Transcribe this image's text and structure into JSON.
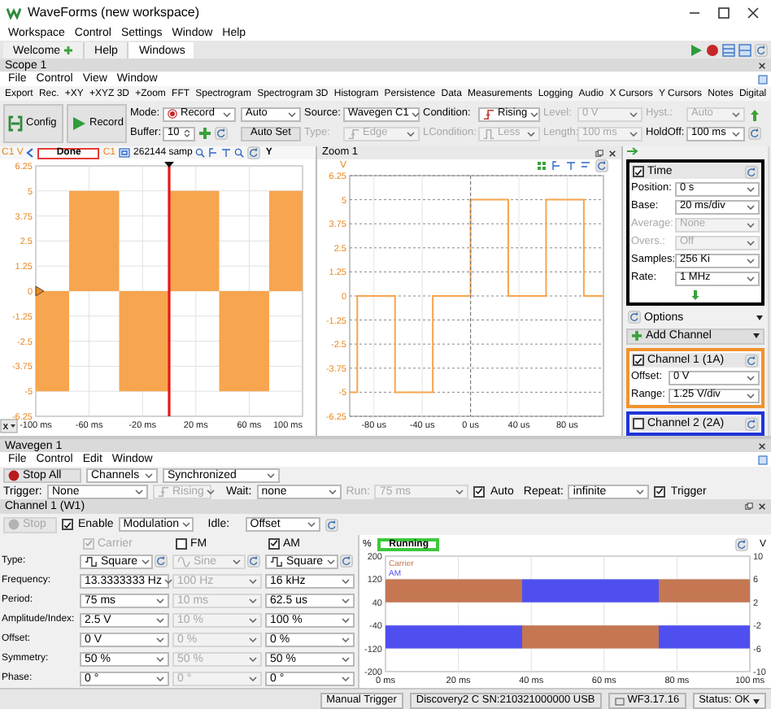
{
  "window": {
    "title": "WaveForms (new workspace)"
  },
  "menu": [
    "Workspace",
    "Control",
    "Settings",
    "Window",
    "Help"
  ],
  "tabs": [
    {
      "label": "Welcome",
      "selected": false
    },
    {
      "label": "Help",
      "selected": false
    },
    {
      "label": "Windows",
      "selected": true
    }
  ],
  "scope": {
    "title": "Scope 1",
    "menu": [
      "File",
      "Control",
      "View",
      "Window"
    ],
    "toolbar": [
      "Export",
      "Rec.",
      "+XY",
      "+XYZ 3D",
      "+Zoom",
      "FFT",
      "Spectrogram",
      "Spectrogram 3D",
      "Histogram",
      "Persistence",
      "Data",
      "Measurements",
      "Logging",
      "Audio",
      "X Cursors",
      "Y Cursors",
      "Notes",
      "Digital"
    ],
    "config": "Config",
    "record": "Record",
    "mode_label": "Mode:",
    "mode": "Record",
    "acquisition": "Auto",
    "buffer_label": "Buffer:",
    "buffer": "10",
    "auto_set": "Auto Set",
    "trigger": [
      {
        "label": "Source:",
        "value": "Wavegen C1",
        "disabled": false,
        "kind": "text"
      },
      {
        "label": "Type:",
        "value": "Edge",
        "disabled": true,
        "kind": "edge"
      },
      {
        "label": "Condition:",
        "value": "Rising",
        "disabled": false,
        "kind": "edge"
      },
      {
        "label": "LCondition:",
        "value": "Less",
        "disabled": true,
        "kind": "pulse"
      },
      {
        "label": "Level:",
        "value": "0 V",
        "disabled": true,
        "kind": "text"
      },
      {
        "label": "Length:",
        "value": "100 ms",
        "disabled": true,
        "kind": "text"
      },
      {
        "label": "Hyst.:",
        "value": "Auto",
        "disabled": true,
        "kind": "text"
      },
      {
        "label": "HoldOff:",
        "value": "100 ms",
        "disabled": false,
        "kind": "text"
      }
    ],
    "plot": {
      "status": "Done",
      "samples": "262144 samp",
      "x_menu": "X",
      "y_menu": "Y",
      "chart_data": {
        "type": "area",
        "ylabel": "C1 V",
        "grid": true,
        "ref_lines": [
          {
            "axis": "x",
            "value": 0,
            "color": "#e01b1b"
          }
        ],
        "xlim": [
          -100,
          100
        ],
        "ylim": [
          -6.25,
          6.25
        ],
        "xticks": [
          {
            "value": -100,
            "label": "-100 ms"
          },
          {
            "value": -60,
            "label": "-60 ms"
          },
          {
            "value": -20,
            "label": "-20 ms"
          },
          {
            "value": 20,
            "label": "20 ms"
          },
          {
            "value": 60,
            "label": "60 ms"
          },
          {
            "value": 100,
            "label": "100 ms"
          }
        ],
        "yticks": [
          6.25,
          5,
          3.75,
          2.5,
          1.25,
          0,
          -1.25,
          -2.5,
          -3.75,
          -5,
          -6.25
        ],
        "x": [
          -100,
          -75,
          -75,
          -37.5,
          -37.5,
          0,
          0,
          37.5,
          37.5,
          75,
          75,
          100
        ],
        "series": [
          {
            "name": "C1",
            "color": "#f7a54f",
            "values": [
              -5,
              -5,
              5,
              5,
              -5,
              -5,
              5,
              5,
              -5,
              -5,
              5,
              5
            ]
          }
        ]
      }
    },
    "zoom": {
      "title": "Zoom 1",
      "chart_data": {
        "type": "line",
        "ylabel": "V",
        "grid": true,
        "ref_lines": [
          {
            "axis": "x",
            "value": 0,
            "color": "#777777"
          }
        ],
        "xlim": [
          -100,
          110
        ],
        "ylim": [
          -6.25,
          6.25
        ],
        "xticks": [
          {
            "value": -80,
            "label": "-80 us"
          },
          {
            "value": -40,
            "label": "-40 us"
          },
          {
            "value": 0,
            "label": "0 us"
          },
          {
            "value": 40,
            "label": "40 us"
          },
          {
            "value": 80,
            "label": "80 us"
          }
        ],
        "yticks": [
          6.25,
          5,
          3.75,
          2.5,
          1.25,
          0,
          -1.25,
          -2.5,
          -3.75,
          -5,
          -6.25
        ],
        "x": [
          -100,
          -93.75,
          -93.75,
          -62.5,
          -62.5,
          -31.25,
          -31.25,
          0,
          0,
          31.25,
          31.25,
          62.5,
          62.5,
          93.75,
          93.75,
          110
        ],
        "series": [
          {
            "color": "#f7a54f",
            "values": [
              -5,
              -5,
              0,
              0,
              -5,
              -5,
              0,
              0,
              5,
              5,
              0,
              0,
              5,
              5,
              0,
              0
            ]
          }
        ]
      }
    },
    "panel": {
      "time": {
        "label": "Time",
        "checked": true,
        "rows": [
          {
            "label": "Position:",
            "value": "0 s",
            "disabled": false
          },
          {
            "label": "Base:",
            "value": "20 ms/div",
            "disabled": false
          },
          {
            "label": "Average:",
            "value": "None",
            "disabled": true
          },
          {
            "label": "Overs.:",
            "value": "Off",
            "disabled": true
          },
          {
            "label": "Samples:",
            "value": "256 Ki",
            "disabled": false
          },
          {
            "label": "Rate:",
            "value": "1 MHz",
            "disabled": false
          }
        ]
      },
      "options": "Options",
      "add_channel": "Add Channel",
      "channels": [
        {
          "label": "Channel 1 (1A)",
          "checked": true,
          "color": "#f0922e",
          "rows": [
            {
              "label": "Offset:",
              "value": "0 V"
            },
            {
              "label": "Range:",
              "value": "1.25 V/div"
            }
          ]
        },
        {
          "label": "Channel 2 (2A)",
          "checked": false,
          "color": "#1f35d8"
        }
      ]
    }
  },
  "wavegen": {
    "title": "Wavegen 1",
    "menu": [
      "File",
      "Control",
      "Edit",
      "Window"
    ],
    "stop_all": "Stop All",
    "channels": "Channels",
    "sync": "Synchronized",
    "trigger_label": "Trigger:",
    "trigger": "None",
    "edge": {
      "value": "Rising",
      "disabled": true
    },
    "wait_label": "Wait:",
    "wait": "none",
    "run_label": "Run:",
    "run": {
      "value": "75 ms",
      "disabled": true
    },
    "auto": {
      "label": "Auto",
      "checked": true
    },
    "repeat_label": "Repeat:",
    "repeat": "infinite",
    "trigger_check": {
      "label": "Trigger",
      "checked": true
    },
    "channel_title": "Channel 1 (W1)",
    "stop": {
      "label": "Stop",
      "disabled": true
    },
    "enable": {
      "label": "Enable",
      "checked": true
    },
    "mode": "Modulation",
    "idle_label": "Idle:",
    "idle": "Offset",
    "columns": [
      {
        "label": "Carrier",
        "checked": true,
        "disabled": true
      },
      {
        "label": "FM",
        "checked": false,
        "disabled": false
      },
      {
        "label": "AM",
        "checked": true,
        "disabled": false
      }
    ],
    "rows": [
      {
        "label": "Type:",
        "kind": "wave",
        "values": [
          {
            "text": "Square",
            "kind": "square"
          },
          {
            "text": "Sine",
            "kind": "sine"
          },
          {
            "text": "Square",
            "kind": "square"
          }
        ]
      },
      {
        "label": "Frequency:",
        "kind": "value",
        "values": [
          "13.3333333 Hz",
          "100 Hz",
          "16 kHz"
        ]
      },
      {
        "label": "Period:",
        "kind": "value",
        "values": [
          "75 ms",
          "10 ms",
          "62.5 us"
        ]
      },
      {
        "label": "Amplitude/Index:",
        "kind": "value",
        "values": [
          "2.5 V",
          "10 %",
          "100 %"
        ]
      },
      {
        "label": "Offset:",
        "kind": "value",
        "values": [
          "0 V",
          "0 %",
          "0 %"
        ]
      },
      {
        "label": "Symmetry:",
        "kind": "value",
        "values": [
          "50 %",
          "50 %",
          "50 %"
        ]
      },
      {
        "label": "Phase:",
        "kind": "value",
        "values": [
          "0 °",
          "0 °",
          "0 °"
        ]
      }
    ],
    "status": "Running",
    "chart_data": {
      "type": "area",
      "ylabel": "%",
      "y2label": "V",
      "grid": true,
      "xlim": [
        0,
        100
      ],
      "ylim": [
        -200,
        200
      ],
      "y2lim": [
        -10,
        10
      ],
      "xticks": [
        {
          "value": 0,
          "label": "0 ms"
        },
        {
          "value": 20,
          "label": "20 ms"
        },
        {
          "value": 40,
          "label": "40 ms"
        },
        {
          "value": 60,
          "label": "60 ms"
        },
        {
          "value": 80,
          "label": "80 ms"
        },
        {
          "value": 100,
          "label": "100 ms"
        }
      ],
      "yticks": [
        200,
        120,
        40,
        -40,
        -120,
        -200
      ],
      "y2ticks": [
        10,
        6,
        2,
        -2,
        -6,
        -10
      ],
      "x": [
        0,
        37.5,
        37.5,
        75,
        75,
        100
      ],
      "series": [
        {
          "name": "Carrier",
          "color": "#c47752",
          "values": [
            120,
            120,
            -120,
            -120,
            120,
            120
          ]
        },
        {
          "name": "AM",
          "color": "#4f4ff0",
          "values": [
            -120,
            -120,
            120,
            120,
            -120,
            -120
          ]
        }
      ]
    }
  },
  "status_bar": [
    "Manual Trigger",
    "Discovery2 C SN:210321000000 USB",
    "WF3.17.16",
    "Status: OK"
  ]
}
